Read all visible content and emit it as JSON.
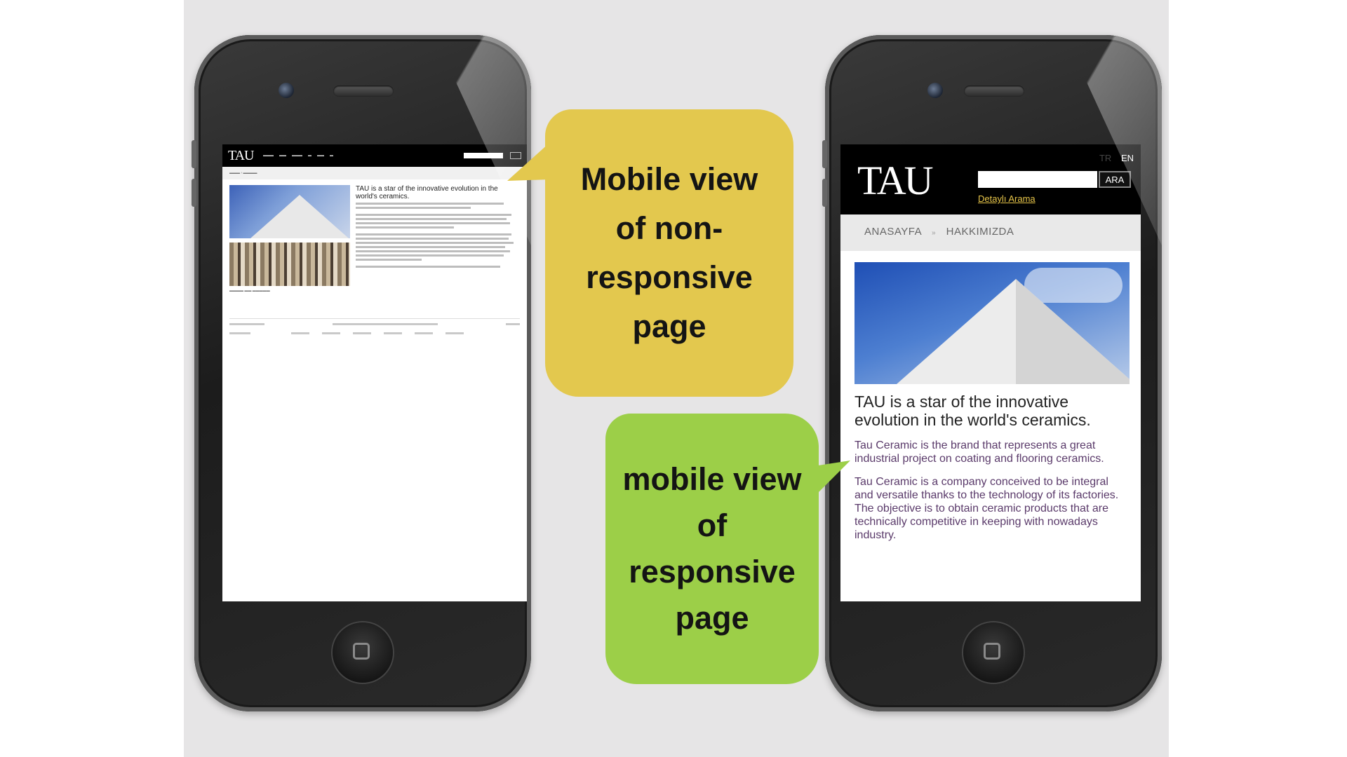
{
  "left_phone": {
    "page": {
      "logo": "TAU",
      "title": "TAU is a star of the innovative evolution in the world's ceramics."
    }
  },
  "right_phone": {
    "page": {
      "logo": "TAU",
      "lang_tr": "TR",
      "lang_en": "EN",
      "search_button": "ARA",
      "detail_link": "Detaylı Arama",
      "breadcrumb_home": "ANASAYFA",
      "breadcrumb_sep": "»",
      "breadcrumb_current": "HAKKIMIZDA",
      "title": "TAU is a star of the innovative evolution in the world's ceramics.",
      "para1": "Tau Ceramic is the brand that represents a great industrial project on coating and flooring ceramics.",
      "para2": "Tau Ceramic is a company conceived to be integral and versatile thanks to the technology of its factories. The objective is to obtain ceramic products that are technically competitive in keeping with nowadays industry."
    }
  },
  "callouts": {
    "yellow": "Mobile view of non-responsive page",
    "green": "mobile view of responsive page"
  },
  "colors": {
    "yellow_bubble": "#e3c84e",
    "green_bubble": "#9ccf48",
    "background": "#e6e5e6"
  }
}
